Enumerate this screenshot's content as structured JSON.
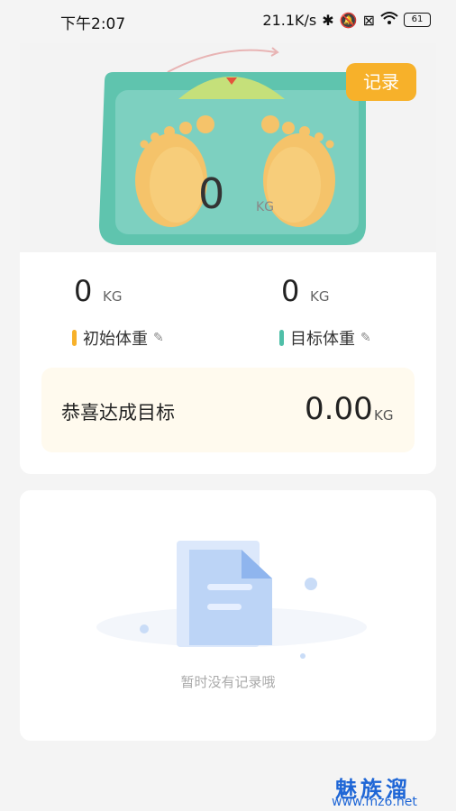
{
  "status_bar": {
    "time": "下午2:07",
    "speed": "21.1K/s",
    "battery": "61"
  },
  "hero": {
    "current_weight": "0",
    "unit": "KG",
    "record_button": "记录"
  },
  "stats": {
    "initial": {
      "value": "0",
      "unit": "KG",
      "label": "初始体重",
      "accent": "#f7b12a"
    },
    "target": {
      "value": "0",
      "unit": "KG",
      "label": "目标体重",
      "accent": "#4fbfa8"
    }
  },
  "goal": {
    "label": "恭喜达成目标",
    "value": "0.00",
    "unit": "KG"
  },
  "empty": {
    "message": "暂时没有记录哦"
  },
  "watermark": {
    "title": "魅族溜",
    "url": "www.mz6.net"
  }
}
